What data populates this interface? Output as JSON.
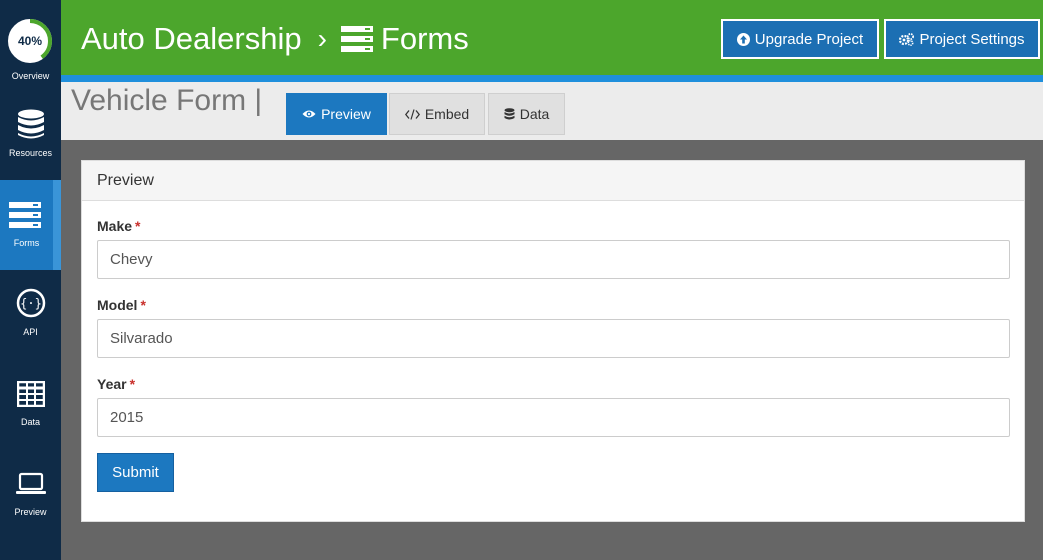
{
  "sidebar": {
    "progress": "40%",
    "progress_fraction": 0.4,
    "items": [
      {
        "label": "Overview",
        "icon": "progress-ring-icon"
      },
      {
        "label": "Resources",
        "icon": "database-icon"
      },
      {
        "label": "Forms",
        "icon": "forms-icon",
        "active": true
      },
      {
        "label": "API",
        "icon": "api-icon"
      },
      {
        "label": "Data",
        "icon": "table-grid-icon"
      },
      {
        "label": "Preview",
        "icon": "laptop-icon"
      }
    ]
  },
  "header": {
    "project": "Auto Dealership",
    "separator": "›",
    "section": "Forms",
    "upgrade_label": "Upgrade Project",
    "settings_label": "Project Settings"
  },
  "subheader": {
    "title": "Vehicle Form |",
    "tabs": [
      {
        "label": "Preview",
        "icon": "eye-icon",
        "active": true
      },
      {
        "label": "Embed",
        "icon": "code-icon"
      },
      {
        "label": "Data",
        "icon": "database-icon"
      }
    ]
  },
  "panel": {
    "title": "Preview",
    "fields": [
      {
        "label": "Make",
        "required": "*",
        "value": "Chevy"
      },
      {
        "label": "Model",
        "required": "*",
        "value": "Silvarado"
      },
      {
        "label": "Year",
        "required": "*",
        "value": "2015"
      }
    ],
    "submit_label": "Submit"
  },
  "colors": {
    "header_green": "#4ca62c",
    "sidebar_navy": "#0f2b47",
    "accent_blue": "#1c78c0",
    "required_red": "#c9302c"
  }
}
